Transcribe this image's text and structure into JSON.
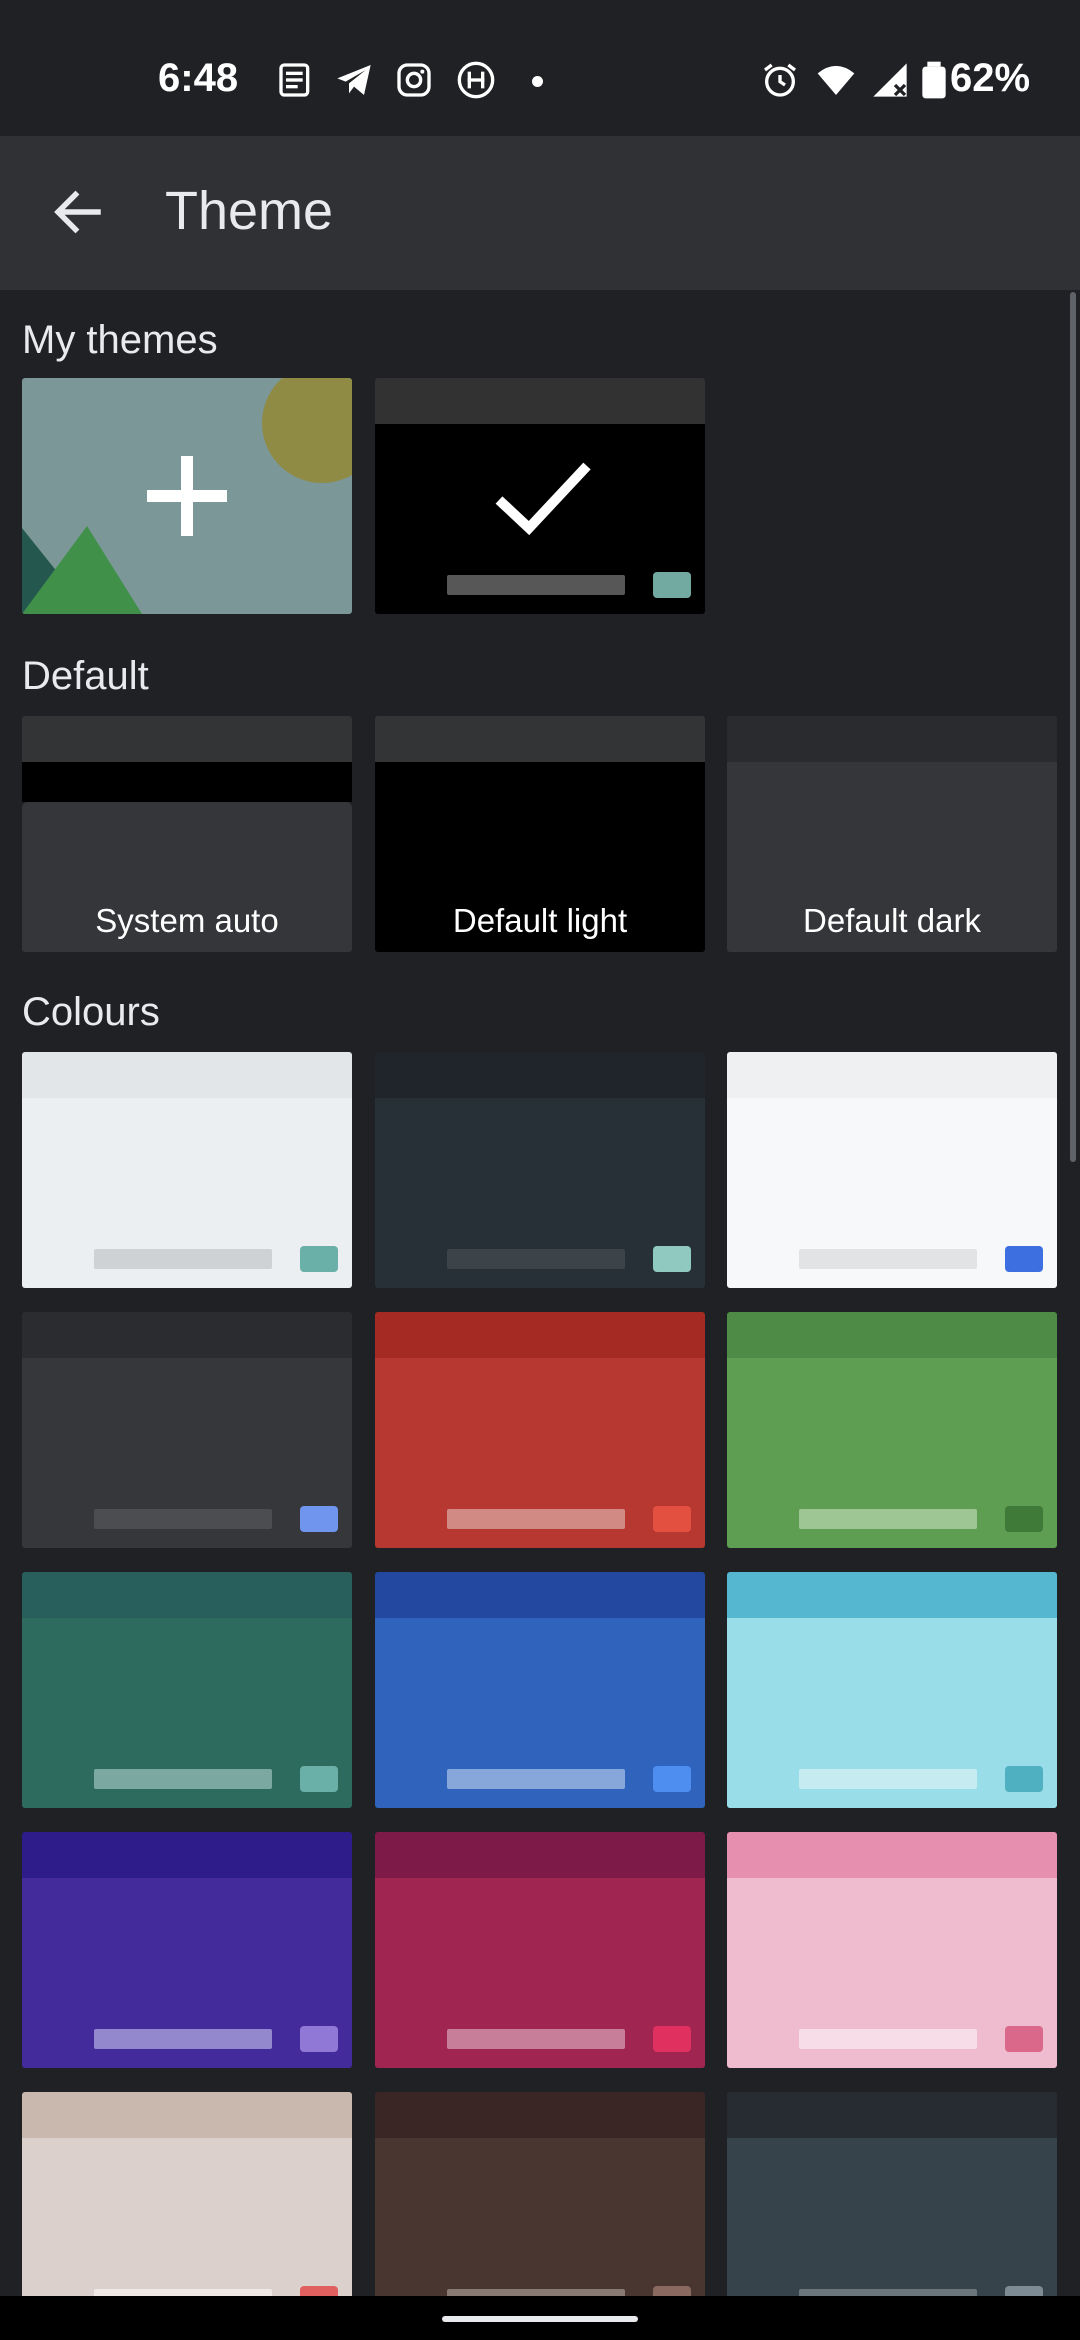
{
  "status_bar": {
    "time": "6:48",
    "battery": "62%",
    "icons": [
      "news-icon",
      "telegram-icon",
      "instagram-icon",
      "circle-app-icon",
      "dot-icon",
      "alarm-icon",
      "wifi-icon",
      "signal-icon",
      "battery-icon"
    ]
  },
  "app_bar": {
    "title": "Theme",
    "back_icon": "arrow-back-icon"
  },
  "sections": {
    "my_themes": "My themes",
    "default": "Default",
    "colours": "Colours"
  },
  "my_themes": [
    {
      "name": "add-theme",
      "icon": "plus-icon"
    },
    {
      "name": "custom-black-selected",
      "icon": "check-icon"
    }
  ],
  "default_themes": [
    {
      "label": "System auto"
    },
    {
      "label": "Default light"
    },
    {
      "label": "Default dark"
    }
  ],
  "colour_themes": [
    {
      "top": "#e3e6e8",
      "body": "#eceff1",
      "bar": "#cfd2d4",
      "chip": "#6ab0a8"
    },
    {
      "top": "#1f252a",
      "body": "#283037",
      "bar": "#3c4349",
      "chip": "#8fc9c0"
    },
    {
      "top": "#eff0f1",
      "body": "#f7f8f9",
      "bar": "#e2e3e4",
      "chip": "#3e6fe0"
    },
    {
      "top": "#2a2c30",
      "body": "#35373a",
      "bar": "#4b4d51",
      "chip": "#6f95ef"
    },
    {
      "top": "#a52a24",
      "body": "#b73830",
      "bar": "#d28a84",
      "chip": "#e35040"
    },
    {
      "top": "#4e8b47",
      "body": "#5d9e52",
      "bar": "#9ec594",
      "chip": "#3f7a38"
    },
    {
      "top": "#285f5c",
      "body": "#2c6b5e",
      "bar": "#7ba8a1",
      "chip": "#6ab0a8"
    },
    {
      "top": "#2248a0",
      "body": "#2f63bc",
      "bar": "#87a6d9",
      "chip": "#4d8ef0"
    },
    {
      "top": "#56b8d0",
      "body": "#98dde8",
      "bar": "#c6ecf2",
      "chip": "#4fb0c2"
    },
    {
      "top": "#2d1c8a",
      "body": "#442b9b",
      "bar": "#9387cd",
      "chip": "#8f78d6"
    },
    {
      "top": "#7e1a48",
      "body": "#a02551",
      "bar": "#c67e99",
      "chip": "#e03060"
    },
    {
      "top": "#e78fae",
      "body": "#efbccf",
      "bar": "#f7dde7",
      "chip": "#d9688a"
    },
    {
      "top": "#c9b8ae",
      "body": "#dbd0cb",
      "bar": "#efe8e4",
      "chip": "#e06060"
    },
    {
      "top": "#3a2624",
      "body": "#4a3631",
      "bar": "#8a7a74",
      "chip": "#8a6a60"
    },
    {
      "top": "#262c31",
      "body": "#37434a",
      "bar": "#6b767c",
      "chip": "#7d8c94"
    }
  ]
}
